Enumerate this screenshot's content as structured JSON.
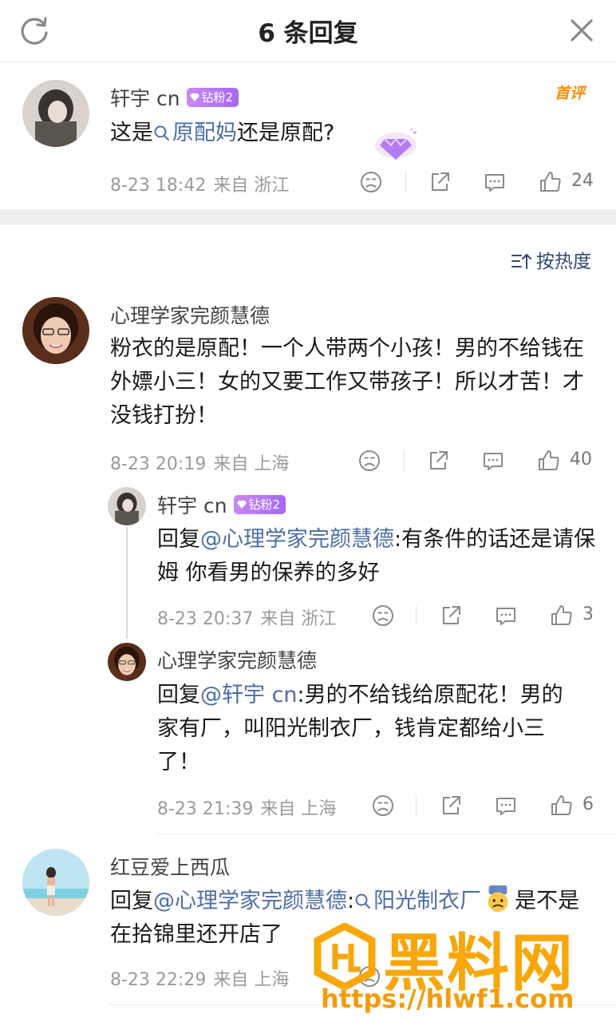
{
  "header": {
    "title": "6 条回复"
  },
  "sort": {
    "label": "按热度"
  },
  "top_comment": {
    "name": "轩宇 cn",
    "badge": "钻粉2",
    "first_tag": "首评",
    "text_before": "这是",
    "topic": "原配妈",
    "text_after": "还是原配?",
    "time": "8-23 18:42",
    "source": "来自 浙江",
    "likes": "24"
  },
  "comment1": {
    "name": "心理学家完颜慧德",
    "text": "粉衣的是原配！一个人带两个小孩！男的不给钱在外嫖小三！女的又要工作又带孩子！所以才苦！才没钱打扮！",
    "time": "8-23 20:19",
    "source": "来自 上海",
    "likes": "40"
  },
  "reply1": {
    "name": "轩宇 cn",
    "badge": "钻粉2",
    "prefix": "回复",
    "mention": "@心理学家完颜慧德",
    "text": ":有条件的话还是请保姆 你看男的保养的多好",
    "time": "8-23 20:37",
    "source": "来自 浙江",
    "likes": "3"
  },
  "reply2": {
    "name": "心理学家完颜慧德",
    "prefix": "回复",
    "mention": "@轩宇 cn",
    "text": ":男的不给钱给原配花！男的家有厂，叫阳光制衣厂，钱肯定都给小三了！",
    "time": "8-23 21:39",
    "source": "来自 上海",
    "likes": "6"
  },
  "comment2": {
    "name": "红豆爱上西瓜",
    "prefix": "回复",
    "mention": "@心理学家完颜慧德",
    "colon": ":",
    "topic": "阳光制衣厂",
    "text_after": "是不是在拾锦里还开店了",
    "time": "8-23 22:29",
    "source": "来自 上海"
  },
  "watermark": {
    "text": "黑料网",
    "url": "https://hlwf1.com"
  },
  "colors": {
    "link": "#4c6ea4",
    "badge": "#b57cf2",
    "watermark": "#f7a70a"
  }
}
